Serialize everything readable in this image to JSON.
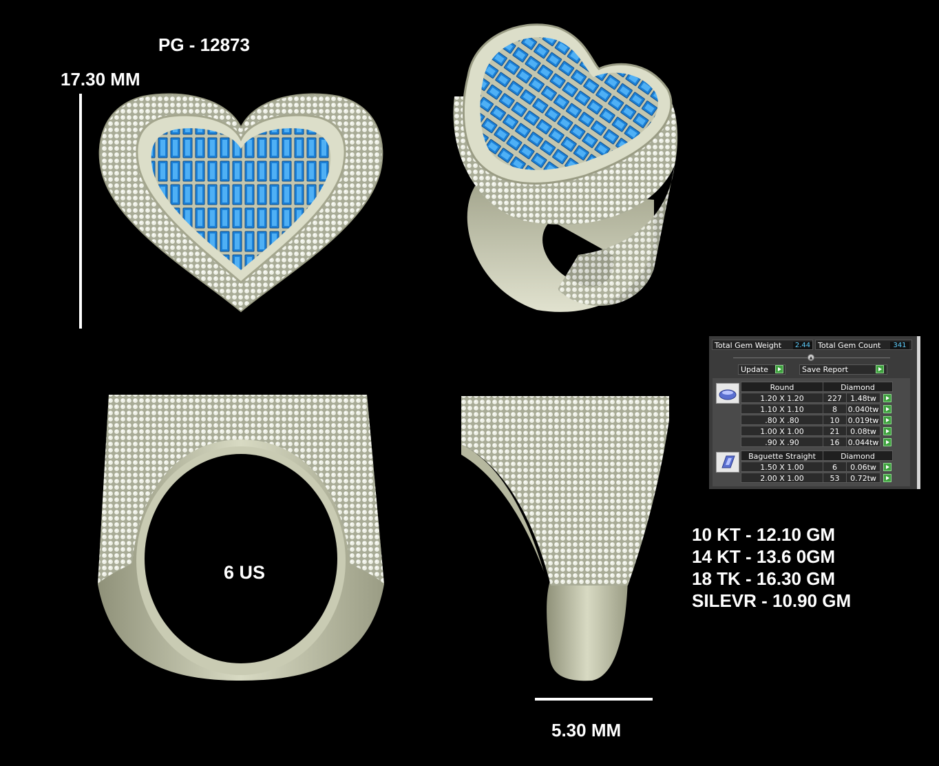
{
  "design": {
    "code": "PG - 12873",
    "height_dimension": "17.30 MM",
    "width_dimension": "5.30 MM",
    "ring_size": "6 US"
  },
  "weights": [
    "10 KT - 12.10 GM",
    "14 KT - 13.6 0GM",
    "18 TK - 16.30 GM",
    "SILEVR - 10.90 GM"
  ],
  "gem_report": {
    "total_weight_label": "Total Gem Weight",
    "total_weight_value": "2.44",
    "total_count_label": "Total Gem Count",
    "total_count_value": "341",
    "update_label": "Update",
    "save_report_label": "Save Report",
    "groups": [
      {
        "shape": "Round",
        "material": "Diamond",
        "icon": "round-stone-icon",
        "rows": [
          {
            "size": "1.20 X 1.20",
            "count": "227",
            "weight": "1.48tw"
          },
          {
            "size": "1.10 X 1.10",
            "count": "8",
            "weight": "0.040tw"
          },
          {
            "size": ".80 X .80",
            "count": "10",
            "weight": "0.019tw"
          },
          {
            "size": "1.00 X 1.00",
            "count": "21",
            "weight": "0.08tw"
          },
          {
            "size": ".90 X .90",
            "count": "16",
            "weight": "0.044tw"
          }
        ]
      },
      {
        "shape": "Baguette Straight",
        "material": "Diamond",
        "icon": "baguette-stone-icon",
        "rows": [
          {
            "size": "1.50 X 1.00",
            "count": "6",
            "weight": "0.06tw"
          },
          {
            "size": "2.00 X 1.00",
            "count": "53",
            "weight": "0.72tw"
          }
        ]
      }
    ]
  },
  "colors": {
    "metal": "#c9cbb3",
    "blue_stone": "#1e8fe0",
    "background": "#000000",
    "value_text": "#5fd0ff",
    "play_button": "#3fa23f"
  }
}
